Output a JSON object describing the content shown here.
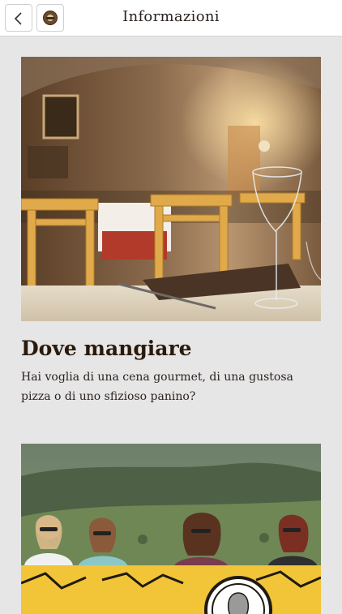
{
  "header": {
    "title": "Informazioni",
    "back_icon": "chevron-left-icon",
    "logo_icon": "logo-icon"
  },
  "cards": [
    {
      "title": "Dove mangiare",
      "description": "Hai voglia di una cena gourmet, di una gustosa pizza o di uno sfizioso panino?",
      "image": "restaurant-interior-photo"
    },
    {
      "title": "",
      "description": "",
      "image": "group-of-people-landscape-photo"
    }
  ],
  "colors": {
    "background": "#e7e6e6",
    "header": "#ffffff",
    "title_text": "#2a1a0c"
  }
}
